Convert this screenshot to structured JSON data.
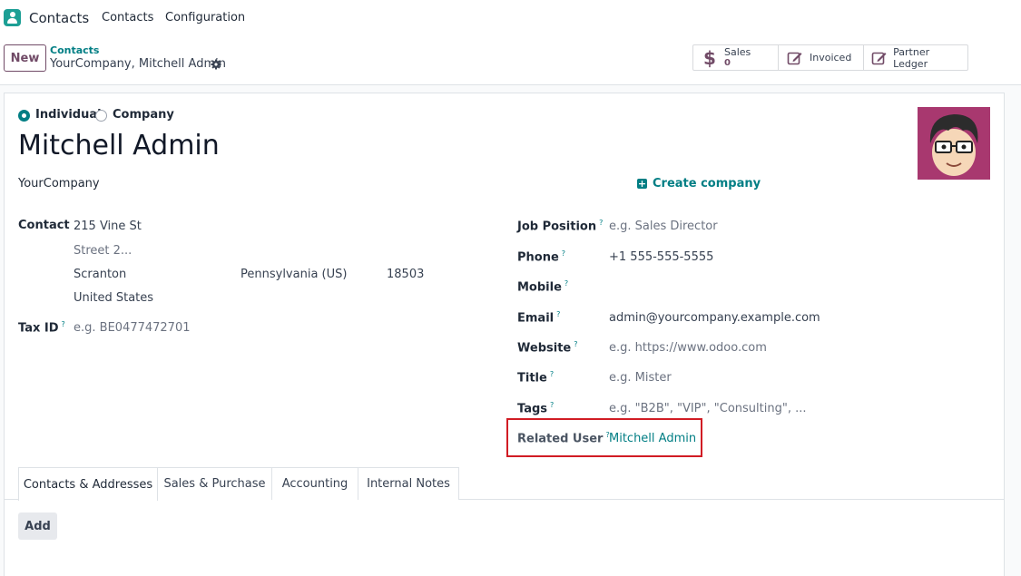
{
  "app": {
    "name": "Contacts",
    "menu": [
      "Contacts",
      "Configuration"
    ]
  },
  "control_panel": {
    "new_label": "New",
    "breadcrumb_parent": "Contacts",
    "breadcrumb_current": "YourCompany, Mitchell Admin",
    "smart_buttons": {
      "sales_label": "Sales",
      "sales_value": "0",
      "invoiced_label": "Invoiced",
      "ledger_label": "Partner Ledger"
    }
  },
  "form": {
    "type_individual": "Individual",
    "type_company": "Company",
    "selected_type": "Individual",
    "name": "Mitchell Admin",
    "company": "YourCompany",
    "create_company_label": "Create company",
    "left": {
      "contact_label": "Contact",
      "street": "215 Vine St",
      "street2_placeholder": "Street 2...",
      "city": "Scranton",
      "state": "Pennsylvania (US)",
      "zip": "18503",
      "country": "United States",
      "tax_id_label": "Tax ID",
      "tax_id_placeholder": "e.g. BE0477472701"
    },
    "right": {
      "job_position_label": "Job Position",
      "job_position_placeholder": "e.g. Sales Director",
      "phone_label": "Phone",
      "phone_value": "+1 555-555-5555",
      "mobile_label": "Mobile",
      "email_label": "Email",
      "email_value": "admin@yourcompany.example.com",
      "website_label": "Website",
      "website_placeholder": "e.g. https://www.odoo.com",
      "title_label": "Title",
      "title_placeholder": "e.g. Mister",
      "tags_label": "Tags",
      "tags_placeholder": "e.g. \"B2B\", \"VIP\", \"Consulting\", ...",
      "related_user_label": "Related User",
      "related_user_value": "Mitchell Admin"
    },
    "help_mark": "?",
    "tabs": [
      "Contacts & Addresses",
      "Sales & Purchase",
      "Accounting",
      "Internal Notes"
    ],
    "active_tab": "Contacts & Addresses",
    "add_label": "Add"
  },
  "colors": {
    "accent": "#017e84",
    "brand": "#714b67",
    "highlight": "#d11c24"
  }
}
